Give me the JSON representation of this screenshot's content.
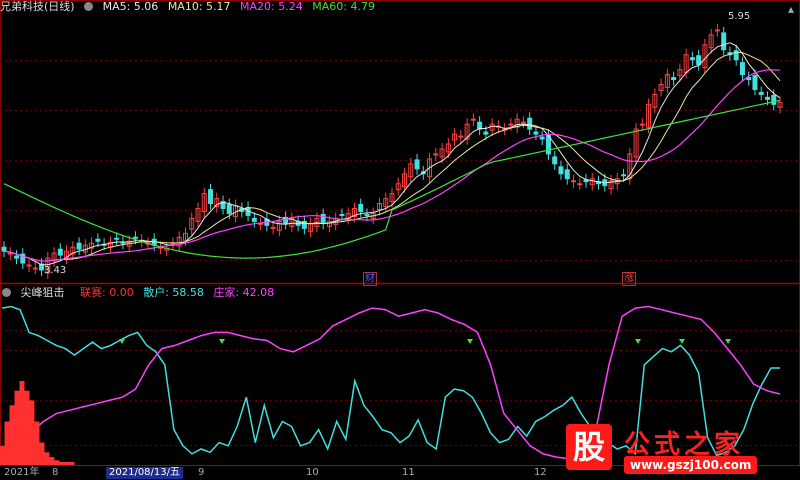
{
  "upper": {
    "title": "兄弟科技(日线)",
    "ma": [
      {
        "label": "MA5: 5.06",
        "color": "#e8e8e8"
      },
      {
        "label": "MA10: 5.17",
        "color": "#e8e8a0"
      },
      {
        "label": "MA20: 5.24",
        "color": "#ff40ff"
      },
      {
        "label": "MA60: 4.79",
        "color": "#40e040"
      }
    ],
    "high_label": "5.95",
    "low_label": "3.43",
    "marker_cai": "财",
    "marker_zhang": "涨"
  },
  "lower": {
    "title": "尖峰狙击",
    "fields": [
      {
        "label": "联赛: 0.00",
        "color": "#ff3030"
      },
      {
        "label": "散户: 58.58",
        "color": "#40e0e0"
      },
      {
        "label": "庄家: 42.08",
        "color": "#ff40ff"
      }
    ]
  },
  "xaxis": {
    "year": "2021年",
    "months": [
      "8",
      "9",
      "10",
      "11",
      "12"
    ],
    "cursor": "2021/08/13/五"
  },
  "watermark": {
    "gu": "股",
    "title": "公式之家",
    "url": "www.gszj100.com"
  },
  "chart_data": [
    {
      "type": "candlestick",
      "title": "兄弟科技(日线)",
      "high_label": 5.95,
      "low_label": 3.43,
      "close": [
        3.62,
        3.6,
        3.55,
        3.5,
        3.48,
        3.45,
        3.43,
        3.55,
        3.6,
        3.58,
        3.62,
        3.66,
        3.64,
        3.68,
        3.7,
        3.72,
        3.69,
        3.71,
        3.74,
        3.7,
        3.72,
        3.75,
        3.73,
        3.7,
        3.68,
        3.66,
        3.65,
        3.7,
        3.76,
        3.8,
        3.95,
        4.05,
        4.2,
        4.1,
        4.15,
        4.05,
        4.0,
        4.08,
        4.02,
        3.98,
        3.92,
        3.9,
        3.88,
        3.86,
        3.92,
        3.9,
        3.95,
        3.88,
        3.85,
        3.9,
        3.95,
        3.9,
        3.92,
        3.95,
        3.98,
        4.0,
        4.05,
        4.02,
        3.98,
        4.0,
        4.1,
        4.15,
        4.2,
        4.3,
        4.4,
        4.5,
        4.45,
        4.4,
        4.55,
        4.6,
        4.65,
        4.7,
        4.8,
        4.78,
        4.9,
        4.95,
        4.85,
        4.8,
        4.9,
        4.88,
        4.85,
        4.9,
        4.95,
        4.92,
        4.85,
        4.8,
        4.75,
        4.6,
        4.5,
        4.4,
        4.35,
        4.33,
        4.3,
        4.32,
        4.35,
        4.3,
        4.28,
        4.33,
        4.35,
        4.38,
        4.6,
        4.85,
        4.9,
        5.1,
        5.2,
        5.3,
        5.4,
        5.35,
        5.45,
        5.6,
        5.55,
        5.5,
        5.7,
        5.8,
        5.85,
        5.65,
        5.6,
        5.55,
        5.4,
        5.35,
        5.25,
        5.2,
        5.15,
        5.1,
        5.12
      ],
      "ma60_end": 4.79
    },
    {
      "type": "line",
      "title": "尖峰狙击",
      "ylim": [
        0,
        100
      ],
      "series": [
        {
          "name": "散户",
          "color": "#40e0e0",
          "values": [
            95,
            96,
            94,
            80,
            78,
            75,
            72,
            70,
            66,
            70,
            74,
            70,
            72,
            75,
            78,
            80,
            72,
            68,
            60,
            20,
            10,
            5,
            8,
            6,
            12,
            10,
            22,
            40,
            12,
            35,
            15,
            25,
            22,
            10,
            12,
            20,
            8,
            25,
            14,
            50,
            35,
            28,
            20,
            18,
            12,
            16,
            26,
            12,
            8,
            40,
            45,
            44,
            40,
            30,
            18,
            12,
            14,
            22,
            16,
            25,
            28,
            32,
            35,
            40,
            30,
            22,
            16,
            12,
            8,
            10,
            5,
            60,
            65,
            70,
            68,
            72,
            66,
            55,
            15,
            4,
            6,
            10,
            20,
            36,
            48,
            58,
            58
          ]
        },
        {
          "name": "庄家",
          "color": "#ff40ff",
          "values": [
            0,
            5,
            18,
            25,
            30,
            32,
            34,
            36,
            38,
            40,
            45,
            60,
            70,
            72,
            75,
            78,
            80,
            80,
            78,
            76,
            75,
            70,
            68,
            72,
            76,
            84,
            88,
            92,
            95,
            94,
            90,
            92,
            94,
            92,
            88,
            85,
            80,
            60,
            30,
            20,
            10,
            5,
            3,
            2,
            1,
            20,
            60,
            90,
            95,
            96,
            94,
            92,
            90,
            88,
            80,
            70,
            60,
            48,
            44,
            42
          ]
        },
        {
          "name": "联赛",
          "color": "#ff3030",
          "values": [
            10,
            25,
            35,
            44,
            50,
            44,
            38,
            25,
            12,
            6,
            3,
            1,
            0,
            0,
            0
          ]
        }
      ]
    }
  ]
}
